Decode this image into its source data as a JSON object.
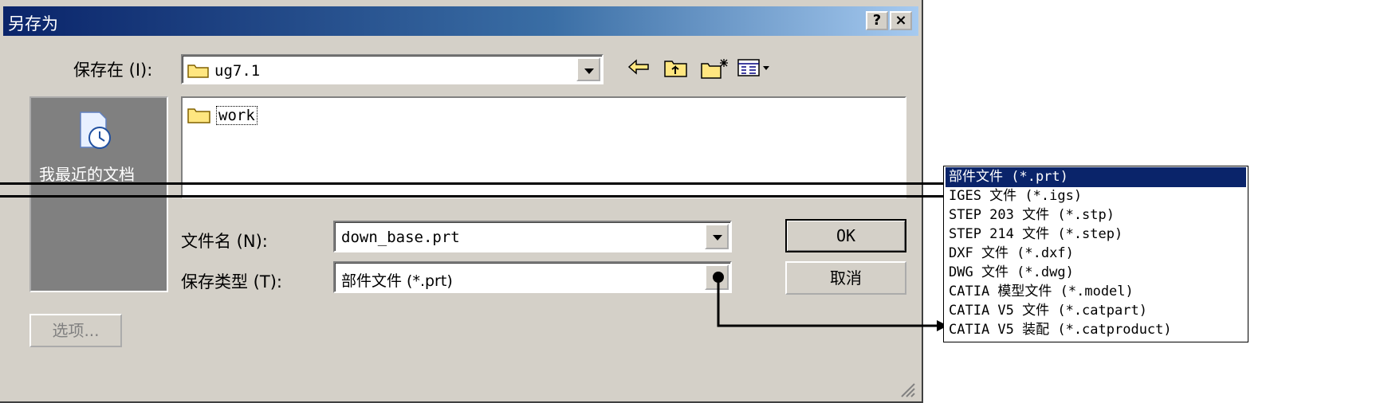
{
  "dialog": {
    "title": "另存为",
    "help_button": "?",
    "close_button": "×",
    "save_in_label": "保存在 (I):",
    "save_in_value": "ug7.1",
    "places": {
      "recent_label": "我最近的文档"
    },
    "files": [
      {
        "name": "work"
      }
    ],
    "filename_label": "文件名 (N):",
    "filename_value": "down_base.prt",
    "filetype_label": "保存类型 (T):",
    "filetype_value": "部件文件 (*.prt)",
    "ok_label": "OK",
    "cancel_label": "取消",
    "options_label": "选项..."
  },
  "filetype_options": [
    "部件文件 (*.prt)",
    "IGES 文件 (*.igs)",
    "STEP 203 文件 (*.stp)",
    "STEP 214 文件 (*.step)",
    "DXF 文件 (*.dxf)",
    "DWG 文件 (*.dwg)",
    "CATIA 模型文件 (*.model)",
    "CATIA V5 文件 (*.catpart)",
    "CATIA V5 装配 (*.catproduct)"
  ],
  "selected_index": 0,
  "colors": {
    "titlebar": "#0a246a",
    "selection": "#0a246a",
    "face": "#d4d0c8"
  }
}
